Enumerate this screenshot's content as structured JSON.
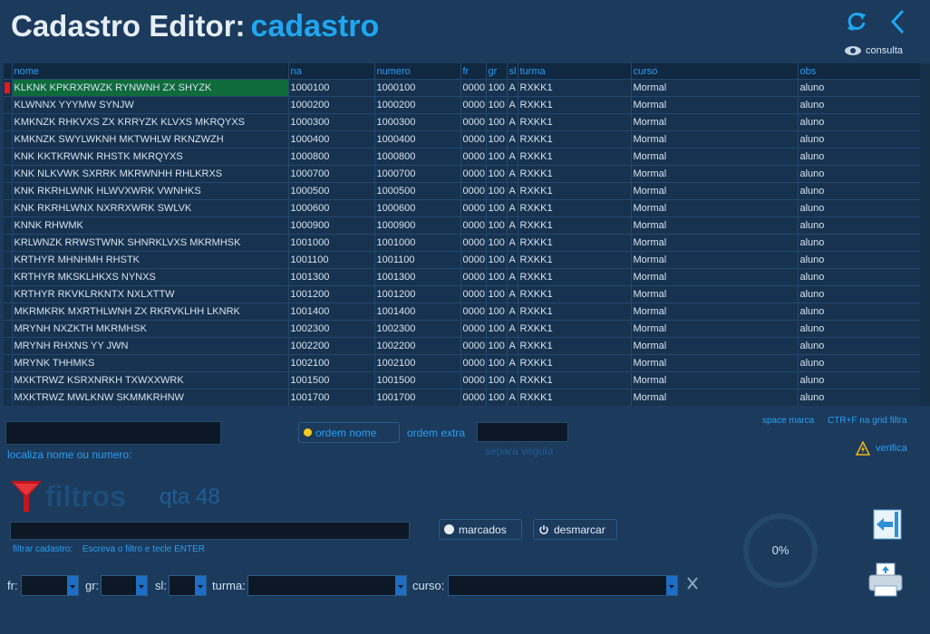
{
  "header": {
    "title": "Cadastro Editor:",
    "subtitle": "cadastro",
    "consulta_label": "consulta"
  },
  "grid": {
    "columns": [
      "nome",
      "na",
      "numero",
      "fr",
      "gr",
      "sl",
      "turma",
      "curso",
      "obs"
    ],
    "rows": [
      [
        "KLKNK KPKRXRWZK RYNWNH ZX SHYZK",
        "1000100",
        "1000100",
        "0000",
        "100",
        "A",
        "RXKK1",
        "Mormal",
        "aluno"
      ],
      [
        "KLWNNX YYYMW SYNJW",
        "1000200",
        "1000200",
        "0000",
        "100",
        "A",
        "RXKK1",
        "Mormal",
        "aluno"
      ],
      [
        "KMKNZK RHKVXS ZX KRRYZK KLVXS MKRQYXS",
        "1000300",
        "1000300",
        "0000",
        "100",
        "A",
        "RXKK1",
        "Mormal",
        "aluno"
      ],
      [
        "KMKNZK SWYLWKNH MKTWHLW RKNZWZH",
        "1000400",
        "1000400",
        "0000",
        "100",
        "A",
        "RXKK1",
        "Mormal",
        "aluno"
      ],
      [
        "KNK KKTKRWNK RHSTK MKRQYXS",
        "1000800",
        "1000800",
        "0000",
        "100",
        "A",
        "RXKK1",
        "Mormal",
        "aluno"
      ],
      [
        "KNK NLKVWK SXRRK MKRWNHH RHLKRXS",
        "1000700",
        "1000700",
        "0000",
        "100",
        "A",
        "RXKK1",
        "Mormal",
        "aluno"
      ],
      [
        "KNK RKRHLWNK HLWVXWRK VWNHKS",
        "1000500",
        "1000500",
        "0000",
        "100",
        "A",
        "RXKK1",
        "Mormal",
        "aluno"
      ],
      [
        "KNK RKRHLWNX NXRRXWRK SWLVK",
        "1000600",
        "1000600",
        "0000",
        "100",
        "A",
        "RXKK1",
        "Mormal",
        "aluno"
      ],
      [
        "KNNK RHWMK",
        "1000900",
        "1000900",
        "0000",
        "100",
        "A",
        "RXKK1",
        "Mormal",
        "aluno"
      ],
      [
        "KRLWNZK RRWSTWNK SHNRKLVXS MKRMHSK",
        "1001000",
        "1001000",
        "0000",
        "100",
        "A",
        "RXKK1",
        "Mormal",
        "aluno"
      ],
      [
        "KRTHYR MHNHMH RHSTK",
        "1001100",
        "1001100",
        "0000",
        "100",
        "A",
        "RXKK1",
        "Mormal",
        "aluno"
      ],
      [
        "KRTHYR MKSKLHKXS NYNXS",
        "1001300",
        "1001300",
        "0000",
        "100",
        "A",
        "RXKK1",
        "Mormal",
        "aluno"
      ],
      [
        "KRTHYR RKVKLRKNTX NXLXTTW",
        "1001200",
        "1001200",
        "0000",
        "100",
        "A",
        "RXKK1",
        "Mormal",
        "aluno"
      ],
      [
        "MKRMKRK MXRTHLWNH ZX RKRVKLHH LKNRK",
        "1001400",
        "1001400",
        "0000",
        "100",
        "A",
        "RXKK1",
        "Mormal",
        "aluno"
      ],
      [
        "MRYNH NXZKTH MKRMHSK",
        "1002300",
        "1002300",
        "0000",
        "100",
        "A",
        "RXKK1",
        "Mormal",
        "aluno"
      ],
      [
        "MRYNH RHXNS YY JWN",
        "1002200",
        "1002200",
        "0000",
        "100",
        "A",
        "RXKK1",
        "Mormal",
        "aluno"
      ],
      [
        "MRYNK THHMKS",
        "1002100",
        "1002100",
        "0000",
        "100",
        "A",
        "RXKK1",
        "Mormal",
        "aluno"
      ],
      [
        "MXKTRWZ KSRXNRKH TXWXXWRK",
        "1001500",
        "1001500",
        "0000",
        "100",
        "A",
        "RXKK1",
        "Mormal",
        "aluno"
      ],
      [
        "MXKTRWZ MWLKNW SKMMKRHNW",
        "1001700",
        "1001700",
        "0000",
        "100",
        "A",
        "RXKK1",
        "Mormal",
        "aluno"
      ]
    ]
  },
  "search": {
    "label": "localiza nome ou numero:",
    "ordem_nome": "ordem nome",
    "ordem_extra": "ordem extra",
    "separa": "separa virgula"
  },
  "hints": {
    "space_marca": "space marca",
    "ctrl_f": "CTR+F na grid filtra",
    "verifica": "verifica"
  },
  "filters": {
    "title": "filtros",
    "qta": "qta 48",
    "hint_label": "filtrar cadastro:",
    "hint_text": "Escreva o filtro e tecle ENTER",
    "marcados": "marcados",
    "desmarcar": "desmarcar",
    "progress": "0%",
    "fr": "fr:",
    "gr": "gr:",
    "sl": "sl:",
    "turma": "turma:",
    "curso": "curso:"
  },
  "colors": {
    "accent": "#1ea7f0",
    "selected_row": "#0f6b3c",
    "marker": "#e01b1b"
  }
}
